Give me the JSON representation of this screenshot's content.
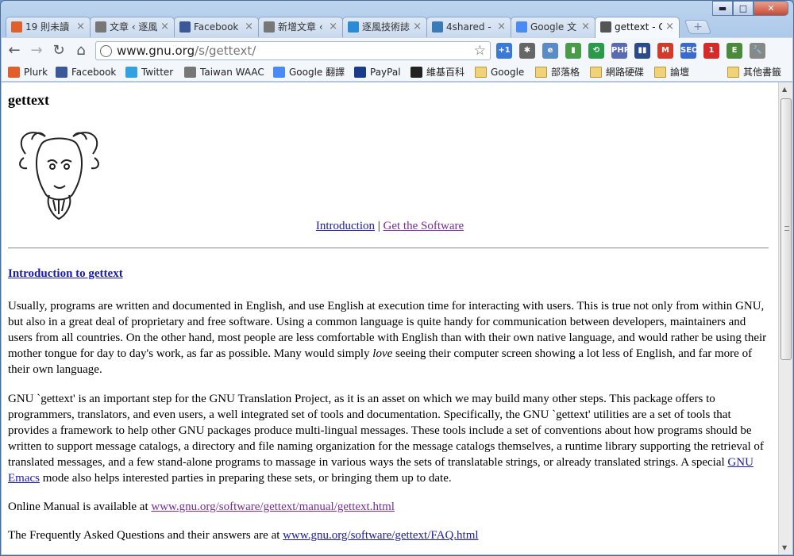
{
  "window": {
    "minimize": "▬",
    "maximize": "□",
    "close": "✕"
  },
  "tabs": [
    {
      "label": "19 則未讀",
      "color": "#e0602c",
      "active": false
    },
    {
      "label": "文章 ‹ 逐風",
      "color": "#777777",
      "active": false
    },
    {
      "label": "Facebook",
      "color": "#3b5998",
      "active": false
    },
    {
      "label": "新增文章 ‹",
      "color": "#777777",
      "active": false
    },
    {
      "label": "逐風技術誌",
      "color": "#2a8ad6",
      "active": false
    },
    {
      "label": "4shared -",
      "color": "#3a7ab8",
      "active": false
    },
    {
      "label": "Google 文",
      "color": "#4a8af4",
      "active": false
    },
    {
      "label": "gettext - G",
      "color": "#555555",
      "active": true
    }
  ],
  "toolbar": {
    "back": "←",
    "forward": "→",
    "reload": "↻",
    "home": "⌂",
    "url_host": "www.gnu.org",
    "url_path": "/s/gettext/",
    "star": "☆",
    "extensions": [
      {
        "label": "+1",
        "color": "#3a7ad6"
      },
      {
        "label": "✱",
        "color": "#666666"
      },
      {
        "label": "e",
        "color": "#5a8ac8"
      },
      {
        "label": "▮",
        "color": "#4a9a4a"
      },
      {
        "label": "⟲",
        "color": "#2a9a4a"
      },
      {
        "label": "PHP",
        "color": "#5a6ab0"
      },
      {
        "label": "▮▮",
        "color": "#2a4a8a"
      },
      {
        "label": "M",
        "color": "#d23a2a"
      },
      {
        "label": "SEO",
        "color": "#3a6ad0"
      },
      {
        "label": "1",
        "color": "#d42a2a"
      },
      {
        "label": "E",
        "color": "#4a8a3a"
      },
      {
        "label": "🔧",
        "color": "#888888"
      }
    ]
  },
  "bookmarks": [
    {
      "label": "Plurk",
      "color": "#e0602c"
    },
    {
      "label": "Facebook",
      "color": "#3b5998"
    },
    {
      "label": "Twitter",
      "color": "#33a0e0"
    },
    {
      "label": "Taiwan WAAC",
      "color": "#777777"
    },
    {
      "label": "Google 翻譯",
      "color": "#4a8af4"
    },
    {
      "label": "PayPal",
      "color": "#1a3a8a"
    },
    {
      "label": "維基百科",
      "color": "#222222"
    },
    {
      "label": "Google",
      "color": "folder"
    },
    {
      "label": "部落格",
      "color": "folder"
    },
    {
      "label": "網路硬碟",
      "color": "folder"
    },
    {
      "label": "論壇",
      "color": "folder"
    },
    {
      "label": "其他書籤",
      "color": "folder"
    }
  ],
  "page": {
    "title": "gettext",
    "nav_intro": "Introduction",
    "nav_sep": " | ",
    "nav_software": "Get the Software",
    "intro_heading": "Introduction to gettext",
    "p1_a": "Usually, programs are written and documented in English, and use English at execution time for interacting with users. This is true not only from within GNU, but also in a great deal of proprietary and free software. Using a common language is quite handy for communication between developers, maintainers and users from all countries. On the other hand, most people are less comfortable with English than with their own native language, and would rather be using their mother tongue for day to day's work, as far as possible. Many would simply ",
    "p1_em": "love",
    "p1_b": " seeing their computer screen showing a lot less of English, and far more of their own language.",
    "p2_a": "GNU `gettext' is an important step for the GNU Translation Project, as it is an asset on which we may build many other steps. This package offers to programmers, translators, and even users, a well integrated set of tools and documentation. Specifically, the GNU `gettext' utilities are a set of tools that provides a framework to help other GNU packages produce multi-lingual messages. These tools include a set of conventions about how programs should be written to support message catalogs, a directory and file naming organization for the message catalogs themselves, a runtime library supporting the retrieval of translated messages, and a few stand-alone programs to massage in various ways the sets of translatable strings, or already translated strings. A special ",
    "p2_link": "GNU Emacs",
    "p2_b": " mode also helps interested parties in preparing these sets, or bringing them up to date.",
    "p3_text": "Online Manual is available at ",
    "p3_link": "www.gnu.org/software/gettext/manual/gettext.html",
    "p4_text": "The Frequently Asked Questions and their answers are at ",
    "p4_link": "www.gnu.org/software/gettext/FAQ.html"
  }
}
